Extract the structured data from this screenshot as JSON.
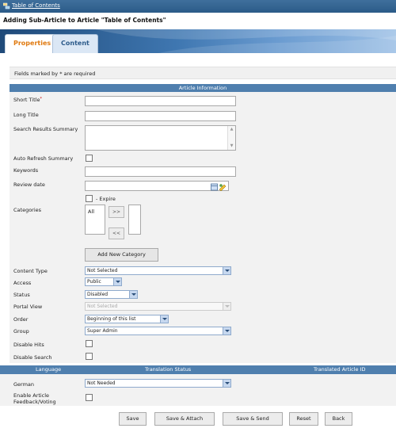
{
  "breadcrumb": {
    "link": "Table of Contents"
  },
  "heading": "Adding Sub-Article to Article \"Table of Contents\"",
  "tabs": [
    "Properties",
    "Content"
  ],
  "required_note": "Fields marked by * are required",
  "section_title": "Article Information",
  "labels": {
    "short_title": "Short Title",
    "long_title": "Long Title",
    "search_summary": "Search Results Summary",
    "auto_refresh": "Auto Refresh Summary",
    "keywords": "Keywords",
    "review_date": "Review date",
    "expire": "- Expire",
    "categories": "Categories",
    "content_type": "Content Type",
    "access": "Access",
    "status": "Status",
    "portal_view": "Portal View",
    "order": "Order",
    "group": "Group",
    "disable_hits": "Disable Hits",
    "disable_search": "Disable Search",
    "german": "German",
    "enable_feedback_1": "Enable Article",
    "enable_feedback_2": "Feedback/Voting"
  },
  "required_marker": "*",
  "categories": {
    "available": [
      "All"
    ],
    "move_right": ">>",
    "move_left": "<<",
    "add_button": "Add New Category"
  },
  "selects": {
    "content_type": "Not Selected",
    "access": "Public",
    "status": "Disabled",
    "portal_view": "Not Selected",
    "order": "Beginning of this list",
    "group": "Super Admin",
    "german": "Not Needed"
  },
  "translation_headers": [
    "Language",
    "Translation Status",
    "Translated Article ID"
  ],
  "buttons": [
    "Save",
    "Save & Attach",
    "Save & Send",
    "Reset",
    "Back"
  ],
  "colors": {
    "header_bar": "#4f7fae",
    "tab_active_text": "#e07a10",
    "select_border": "#8faacc"
  }
}
